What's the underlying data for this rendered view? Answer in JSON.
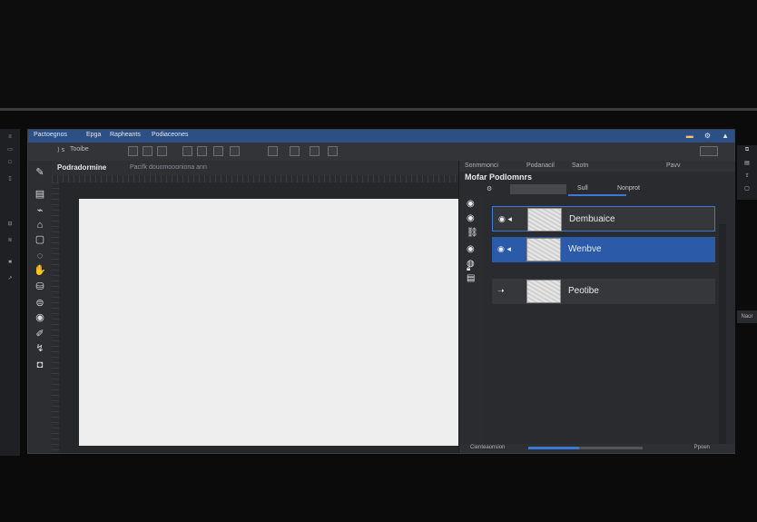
{
  "menubar": {
    "items": [
      "Pactoegnos",
      "Epga",
      "Rapheants",
      "Podiaceones"
    ]
  },
  "optionsbar": {
    "label": "Tooibe"
  },
  "document": {
    "tab_title": "Podradormine",
    "tab_subtitle": "Pacifk douomoooniona ann"
  },
  "panel": {
    "header_left": "Sonmmonci",
    "header_mid": "Podanacil",
    "header_right": "Saotn",
    "header_far": "Pavv",
    "title_left": "Mofar",
    "title": "Podlomnrs",
    "tabs": [
      "Sull",
      "Nonprot"
    ],
    "layers": [
      {
        "name": "Dembuaice",
        "selected": false
      },
      {
        "name": "Wenbve",
        "selected": true
      },
      {
        "name": "Peotibe",
        "selected": false
      }
    ],
    "footer_label": "Cienteaonsion",
    "footer_right": "Ppoen"
  },
  "colors": {
    "accent": "#3c78d8",
    "menubar": "#2c4f86",
    "selected_layer": "#2a5aa8"
  },
  "right_sliver": {
    "bottom_label": "Naor"
  }
}
